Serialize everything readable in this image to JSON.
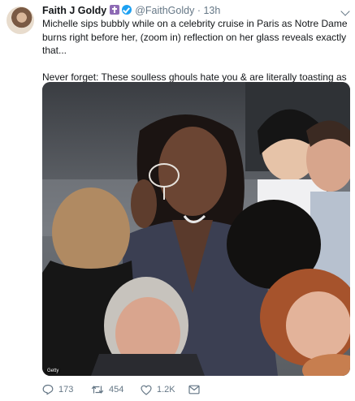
{
  "tweet": {
    "display_name": "Faith J Goldy",
    "handle": "@FaithGoldy",
    "separator": "·",
    "time": "13h",
    "paragraphs": [
      "Michelle sips bubbly while on a celebrity cruise in Paris as Notre Dame burns right before her, (zoom in) reflection on her glass reveals exactly that...",
      "Never forget: These soulless ghouls hate you & are literally toasting as the world bequeathed to us is blown up in flames."
    ],
    "media_credit": "Getty"
  },
  "actions": {
    "reply_count": "173",
    "retweet_count": "454",
    "like_count": "1.2K"
  },
  "icons": [
    "cross-badge-icon",
    "verified-icon",
    "chevron-down-icon",
    "reply-icon",
    "retweet-icon",
    "like-icon",
    "message-icon"
  ],
  "colors": {
    "name_text": "#14171a",
    "meta_text": "#657786",
    "verified_blue": "#1da1f2",
    "badge_purple": "#8e6bb5"
  }
}
